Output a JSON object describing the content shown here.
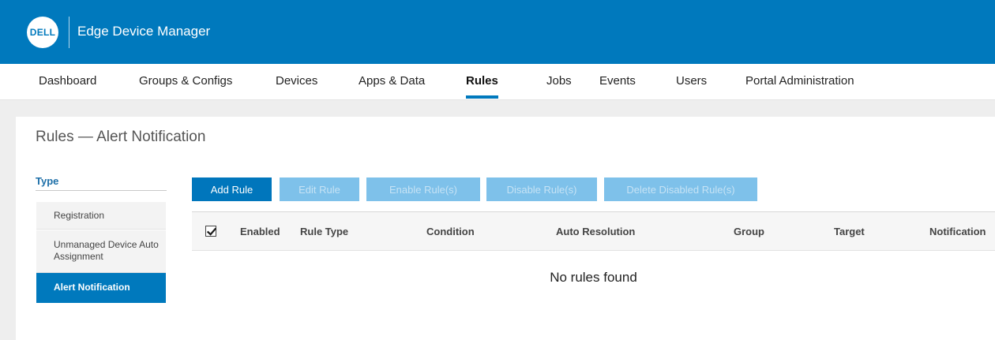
{
  "header": {
    "logo_text": "DELL",
    "app_title": "Edge Device Manager",
    "colors": {
      "brand_blue": "#0079bd",
      "disabled_blue": "#7ec1ea"
    }
  },
  "nav": {
    "items": [
      {
        "label": "Dashboard",
        "active": false
      },
      {
        "label": "Groups & Configs",
        "active": false
      },
      {
        "label": "Devices",
        "active": false
      },
      {
        "label": "Apps & Data",
        "active": false
      },
      {
        "label": "Rules",
        "active": true
      },
      {
        "label": "Jobs",
        "active": false
      },
      {
        "label": "Events",
        "active": false
      },
      {
        "label": "Users",
        "active": false
      },
      {
        "label": "Portal Administration",
        "active": false
      }
    ]
  },
  "page": {
    "title": "Rules — Alert Notification"
  },
  "type_panel": {
    "header": "Type",
    "items": [
      {
        "line1": "Registration",
        "line2": "",
        "active": false
      },
      {
        "line1": "Unmanaged Device Auto",
        "line2": "Assignment",
        "active": false
      },
      {
        "line1": "Alert Notification",
        "line2": "",
        "active": true
      }
    ]
  },
  "toolbar": {
    "add_rule": "Add Rule",
    "edit_rule": "Edit Rule",
    "enable_rules": "Enable Rule(s)",
    "disable_rules": "Disable Rule(s)",
    "delete_disabled_rules": "Delete Disabled Rule(s)"
  },
  "table": {
    "select_all_checked": true,
    "columns": [
      "Enabled",
      "Rule Type",
      "Condition",
      "Auto Resolution",
      "Group",
      "Target",
      "Notification"
    ],
    "empty_message": "No rules found"
  }
}
